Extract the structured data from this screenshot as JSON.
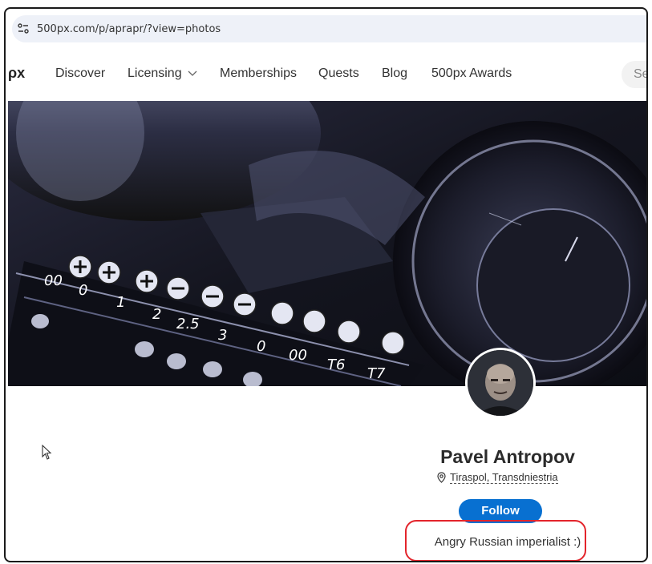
{
  "browser": {
    "url": "500px.com/p/aprapr/?view=photos"
  },
  "nav": {
    "logo": "ρx",
    "items": [
      "Discover",
      "Licensing",
      "Memberships",
      "Quests",
      "Blog",
      "500px Awards"
    ],
    "licensing_chevron": "⌄",
    "search_placeholder": "Se"
  },
  "profile": {
    "name": "Pavel Antropov",
    "location": "Tiraspol, Transdniestria",
    "follow_label": "Follow",
    "bio": "Angry Russian imperialist :)"
  },
  "cover": {
    "bit_labels": [
      "00",
      "0",
      "1",
      "2",
      "2.5",
      "3",
      "0",
      "00",
      "T6",
      "T7"
    ]
  },
  "colors": {
    "follow_button": "#0870d1",
    "highlight": "#e3242b"
  }
}
